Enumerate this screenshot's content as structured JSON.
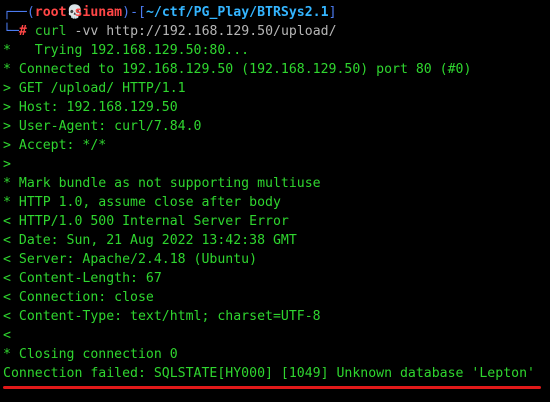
{
  "prompt": {
    "top_corner": "┌──",
    "open_paren": "(",
    "user": "root",
    "skull_icon": "💀",
    "host": "siunam",
    "close_paren_dash_bracket": ")-[",
    "path": "~/ctf/PG_Play/BTRSys2.1",
    "close_bracket": "]",
    "bottom_corner": "└─",
    "hash": "#",
    "command": "curl",
    "flag": "-vv",
    "url": "http://192.168.129.50/upload/"
  },
  "output_lines": [
    "*   Trying 192.168.129.50:80...",
    "* Connected to 192.168.129.50 (192.168.129.50) port 80 (#0)",
    "> GET /upload/ HTTP/1.1",
    "> Host: 192.168.129.50",
    "> User-Agent: curl/7.84.0",
    "> Accept: */*",
    ">",
    "* Mark bundle as not supporting multiuse",
    "* HTTP 1.0, assume close after body",
    "< HTTP/1.0 500 Internal Server Error",
    "< Date: Sun, 21 Aug 2022 13:42:38 GMT",
    "< Server: Apache/2.4.18 (Ubuntu)",
    "< Content-Length: 67",
    "< Connection: close",
    "< Content-Type: text/html; charset=UTF-8",
    "<",
    "* Closing connection 0",
    "Connection failed: SQLSTATE[HY000] [1049] Unknown database 'Lepton'"
  ],
  "colors": {
    "background": "#000000",
    "prompt_frame": "#4c7bf0",
    "prompt_user": "#ff4646",
    "prompt_path": "#34b5ff",
    "output_text": "#2fd62f",
    "highlight_underline": "#e01919"
  }
}
